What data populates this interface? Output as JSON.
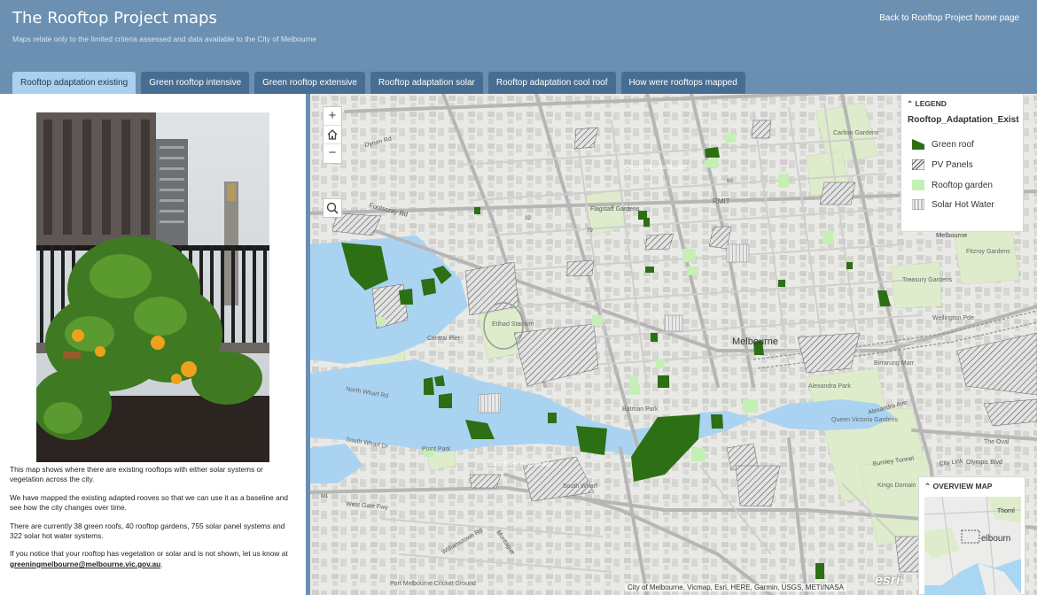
{
  "header": {
    "title": "The Rooftop Project maps",
    "subtitle": "Maps relate only to the limited criteria assessed and data available to the City of Melbourne",
    "home_link": "Back to Rooftop Project home page"
  },
  "tabs": [
    {
      "label": "Rooftop adaptation existing",
      "active": true
    },
    {
      "label": "Green rooftop intensive",
      "active": false
    },
    {
      "label": "Green rooftop extensive",
      "active": false
    },
    {
      "label": "Rooftop adaptation solar",
      "active": false
    },
    {
      "label": "Rooftop adaptation cool roof",
      "active": false
    },
    {
      "label": "How were rooftops mapped",
      "active": false
    }
  ],
  "panel": {
    "p1": "This map shows where there are existing rooftops with either solar systems or vegetation across the city.",
    "p2": "We have mapped the existing adapted rooves so that we can use it as a baseline and see how the city changes over time.",
    "p3": "There are currently 38 green roofs, 40 rooftop gardens, 755 solar panel systems and 322 solar hot water systems.",
    "p4_text": "If you notice that your rooftop has vegetation or solar and is not shown, let us know at",
    "p4_email": "greeningmelbourne@melbourne.vic.gov.au",
    "p4_end": "."
  },
  "map": {
    "zoom_in": "+",
    "zoom_out": "−",
    "home_icon": "home-icon",
    "search_icon": "search-icon",
    "labels": {
      "dynon": "Dynon Rd",
      "footscray": "Footscray Rd",
      "qvm": "Queen Victoria Market",
      "flagstaff": "Flagstaff Gardens",
      "rmit": "RMIT",
      "carlton": "Carlton Gardens",
      "melbourne_top": "Melbourne",
      "fitzroy": "Fitzroy Gardens",
      "treasury": "Treasury Gardens",
      "wellington": "Wellington Pde",
      "etihad": "Etihad Stadium",
      "central_pier": "Central Pier",
      "melbourne_cbd": "Melbourne",
      "birrarung": "Birrarung Marr",
      "alexandra_park": "Alexandra Park",
      "queen_victoria_gardens": "Queen Victoria Gardens",
      "kings_domain": "Kings Domain",
      "north_wharf": "North Wharf Rd",
      "south_wharf_dr": "South Wharf Dr",
      "point_park": "Point Park",
      "batman_park": "Batman Park",
      "yarra": "Yarra River Promenade",
      "south_wharf": "South Wharf",
      "westgate": "West Gate Fwy",
      "city_link": "City Link",
      "port_melbourne": "Port Melbourne Cricket Ground",
      "olympic": "Olympic Blvd",
      "oval": "The Oval",
      "burnley": "Burnley Tunnel",
      "alexandra_ave": "Alexandra Ave",
      "montague": "Montague",
      "williamstown": "Williamstown Rd",
      "m1": "M1",
      "n79": "79",
      "n32": "32",
      "n60": "60"
    },
    "attribution": "City of Melbourne, Vicmap, Esri, HERE, Garmin, USGS, METI/NASA",
    "esri_logo": "esri"
  },
  "legend": {
    "heading": "LEGEND",
    "layer": "Rooftop_Adaptation_Exist",
    "items": [
      {
        "label": "Green roof",
        "swatch": "green-roof"
      },
      {
        "label": "PV Panels",
        "swatch": "pv-hatch"
      },
      {
        "label": "Rooftop garden",
        "swatch": "garden"
      },
      {
        "label": "Solar Hot Water",
        "swatch": "shw-hatch"
      }
    ]
  },
  "overview": {
    "heading": "OVERVIEW MAP",
    "label_north": "Thornl",
    "label_city": "elbourn"
  },
  "colors": {
    "header": "#6b90b2",
    "tab": "#486d92",
    "tab_active": "#a9d0ee",
    "water": "#aad3f2",
    "park": "#dfeccc",
    "green_roof": "#2d6f14",
    "rooftop_garden": "#c5f0b5"
  }
}
